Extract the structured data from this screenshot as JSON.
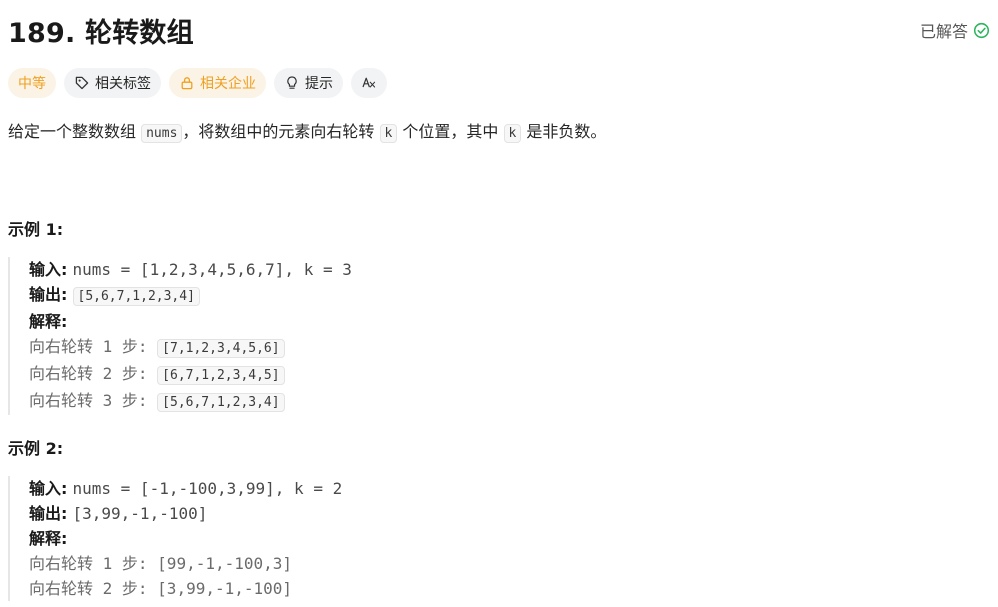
{
  "problem": {
    "title": "189. 轮转数组",
    "solved_label": "已解答"
  },
  "tags": {
    "difficulty": "中等",
    "related_tags": "相关标签",
    "related_companies": "相关企业",
    "hint": "提示"
  },
  "description": {
    "p1": "给定一个整数数组 ",
    "code1": "nums",
    "p2": "，将数组中的元素向右轮转 ",
    "code2": "k",
    "p3": " 个位置，其中 ",
    "code3": "k",
    "p4": " 是非负数。"
  },
  "example1": {
    "title": "示例 1:",
    "input_label": "输入:",
    "input_value": "nums = [1,2,3,4,5,6,7], k = 3",
    "output_label": "输出:",
    "output_value": "[5,6,7,1,2,3,4]",
    "explain_label": "解释:",
    "steps": [
      {
        "text": "向右轮转 1 步: ",
        "value": "[7,1,2,3,4,5,6]"
      },
      {
        "text": "向右轮转 2 步: ",
        "value": "[6,7,1,2,3,4,5]"
      },
      {
        "text": "向右轮转 3 步: ",
        "value": "[5,6,7,1,2,3,4]"
      }
    ]
  },
  "example2": {
    "title": "示例 2:",
    "input_label": "输入:",
    "input_value": "nums = [-1,-100,3,99], k = 2",
    "output_label": "输出:",
    "output_value": "[3,99,-1,-100]",
    "explain_label": "解释:",
    "steps": [
      {
        "text": "向右轮转 1 步: ",
        "value": "[99,-1,-100,3]"
      },
      {
        "text": "向右轮转 2 步: ",
        "value": "[3,99,-1,-100]"
      }
    ]
  },
  "colors": {
    "difficulty_medium": "#f0a020",
    "solved_check": "#2db55d"
  }
}
